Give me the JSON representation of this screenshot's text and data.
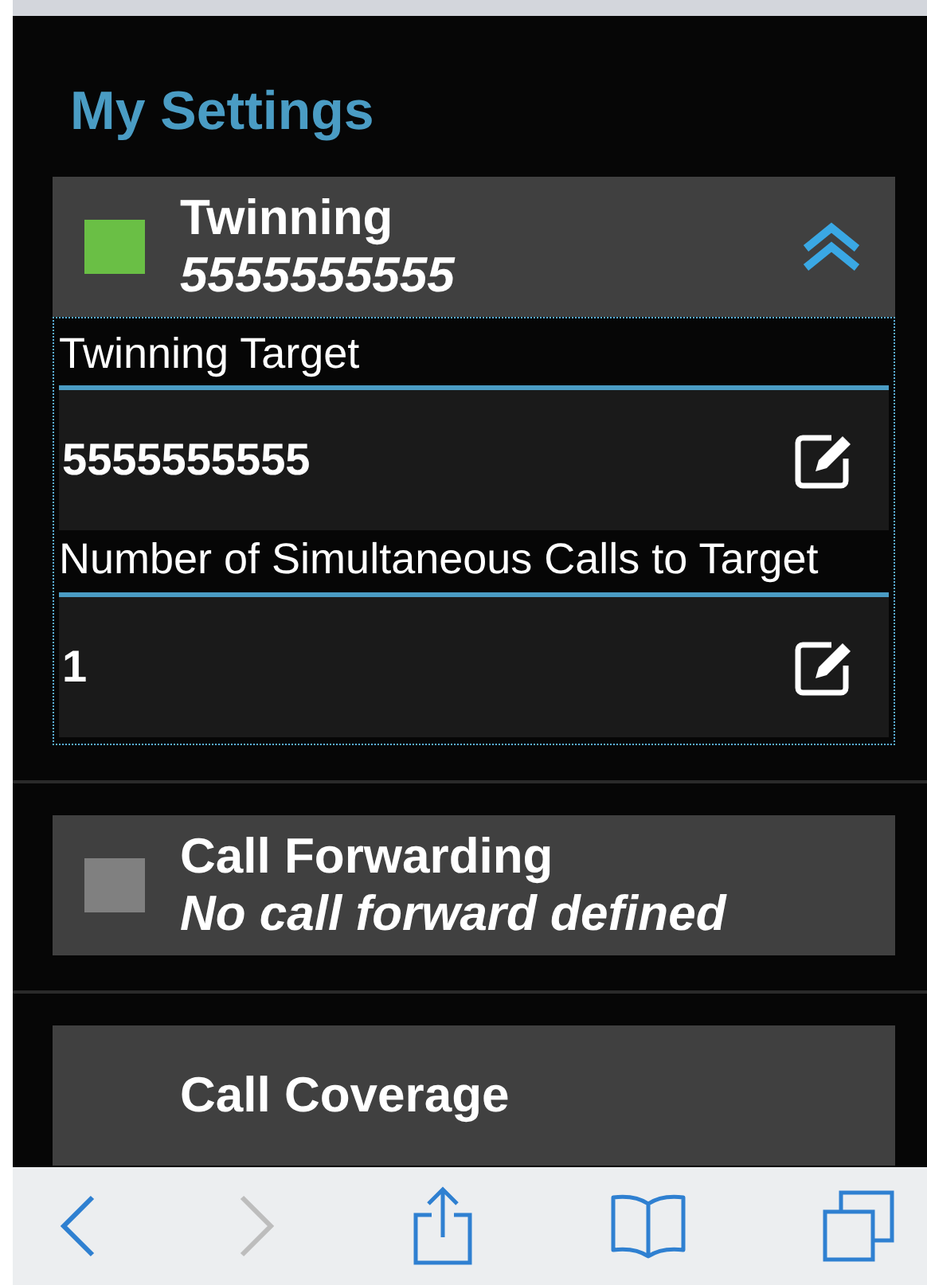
{
  "page": {
    "title": "My Settings"
  },
  "sections": [
    {
      "title": "Twinning",
      "subtitle": "5555555555",
      "color": "#6abf45",
      "expanded": true,
      "fields": [
        {
          "label": "Twinning Target",
          "value": "5555555555"
        },
        {
          "label": "Number of Simultaneous Calls to Target",
          "value": "1"
        }
      ]
    },
    {
      "title": "Call Forwarding",
      "subtitle": "No call forward defined",
      "color": "#808080",
      "expanded": false
    },
    {
      "title": "Call Coverage",
      "expanded": false
    }
  ],
  "toolbar": [
    {
      "kind": "back",
      "disabled": false
    },
    {
      "kind": "forward",
      "disabled": true
    },
    {
      "kind": "share",
      "disabled": false
    },
    {
      "kind": "bookmarks",
      "disabled": false
    },
    {
      "kind": "tabs",
      "disabled": false
    }
  ]
}
